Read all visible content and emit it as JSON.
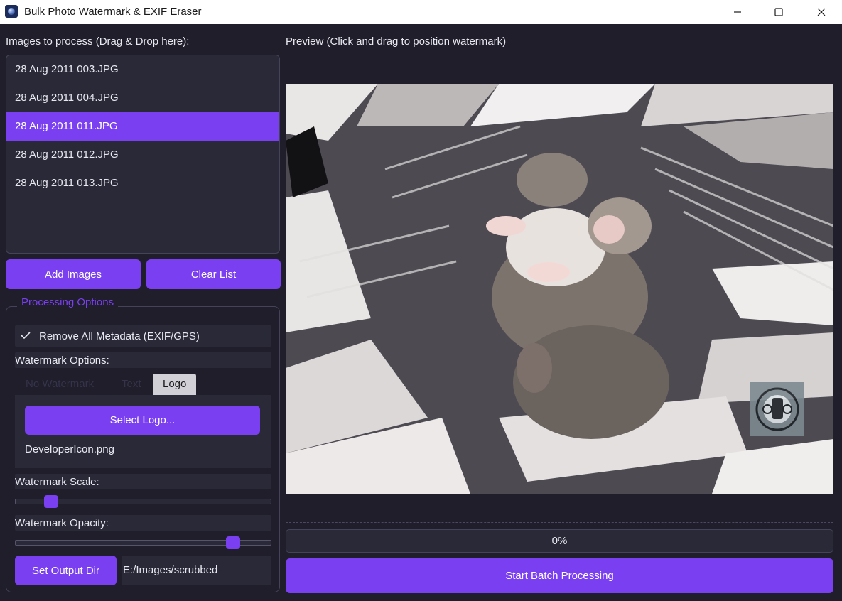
{
  "window": {
    "title": "Bulk Photo Watermark & EXIF Eraser"
  },
  "left": {
    "images_label": "Images to process (Drag & Drop here):",
    "files": [
      {
        "name": "28 Aug 2011 003.JPG",
        "selected": false
      },
      {
        "name": "28 Aug 2011 004.JPG",
        "selected": false
      },
      {
        "name": "28 Aug 2011 011.JPG",
        "selected": true
      },
      {
        "name": "28 Aug 2011 012.JPG",
        "selected": false
      },
      {
        "name": "28 Aug 2011 013.JPG",
        "selected": false
      }
    ],
    "add_images_label": "Add Images",
    "clear_list_label": "Clear List"
  },
  "options": {
    "group_title": "Processing Options",
    "remove_metadata_label": "Remove All Metadata (EXIF/GPS)",
    "remove_metadata_checked": true,
    "watermark_options_label": "Watermark Options:",
    "tabs": [
      "No Watermark",
      "Text",
      "Logo"
    ],
    "active_tab": "Logo",
    "select_logo_label": "Select Logo...",
    "logo_filename": "DeveloperIcon.png",
    "scale_label": "Watermark Scale:",
    "scale_value": 0.12,
    "opacity_label": "Watermark Opacity:",
    "opacity_value": 0.87,
    "set_output_label": "Set Output Dir",
    "output_path": "E:/Images/scrubbed"
  },
  "preview": {
    "label": "Preview (Click and drag to position watermark)",
    "progress_text": "0%",
    "progress_value": 0,
    "start_label": "Start Batch Processing"
  },
  "colors": {
    "accent": "#7a3ff0",
    "background": "#1f1e2a",
    "panel": "#2a2938"
  }
}
